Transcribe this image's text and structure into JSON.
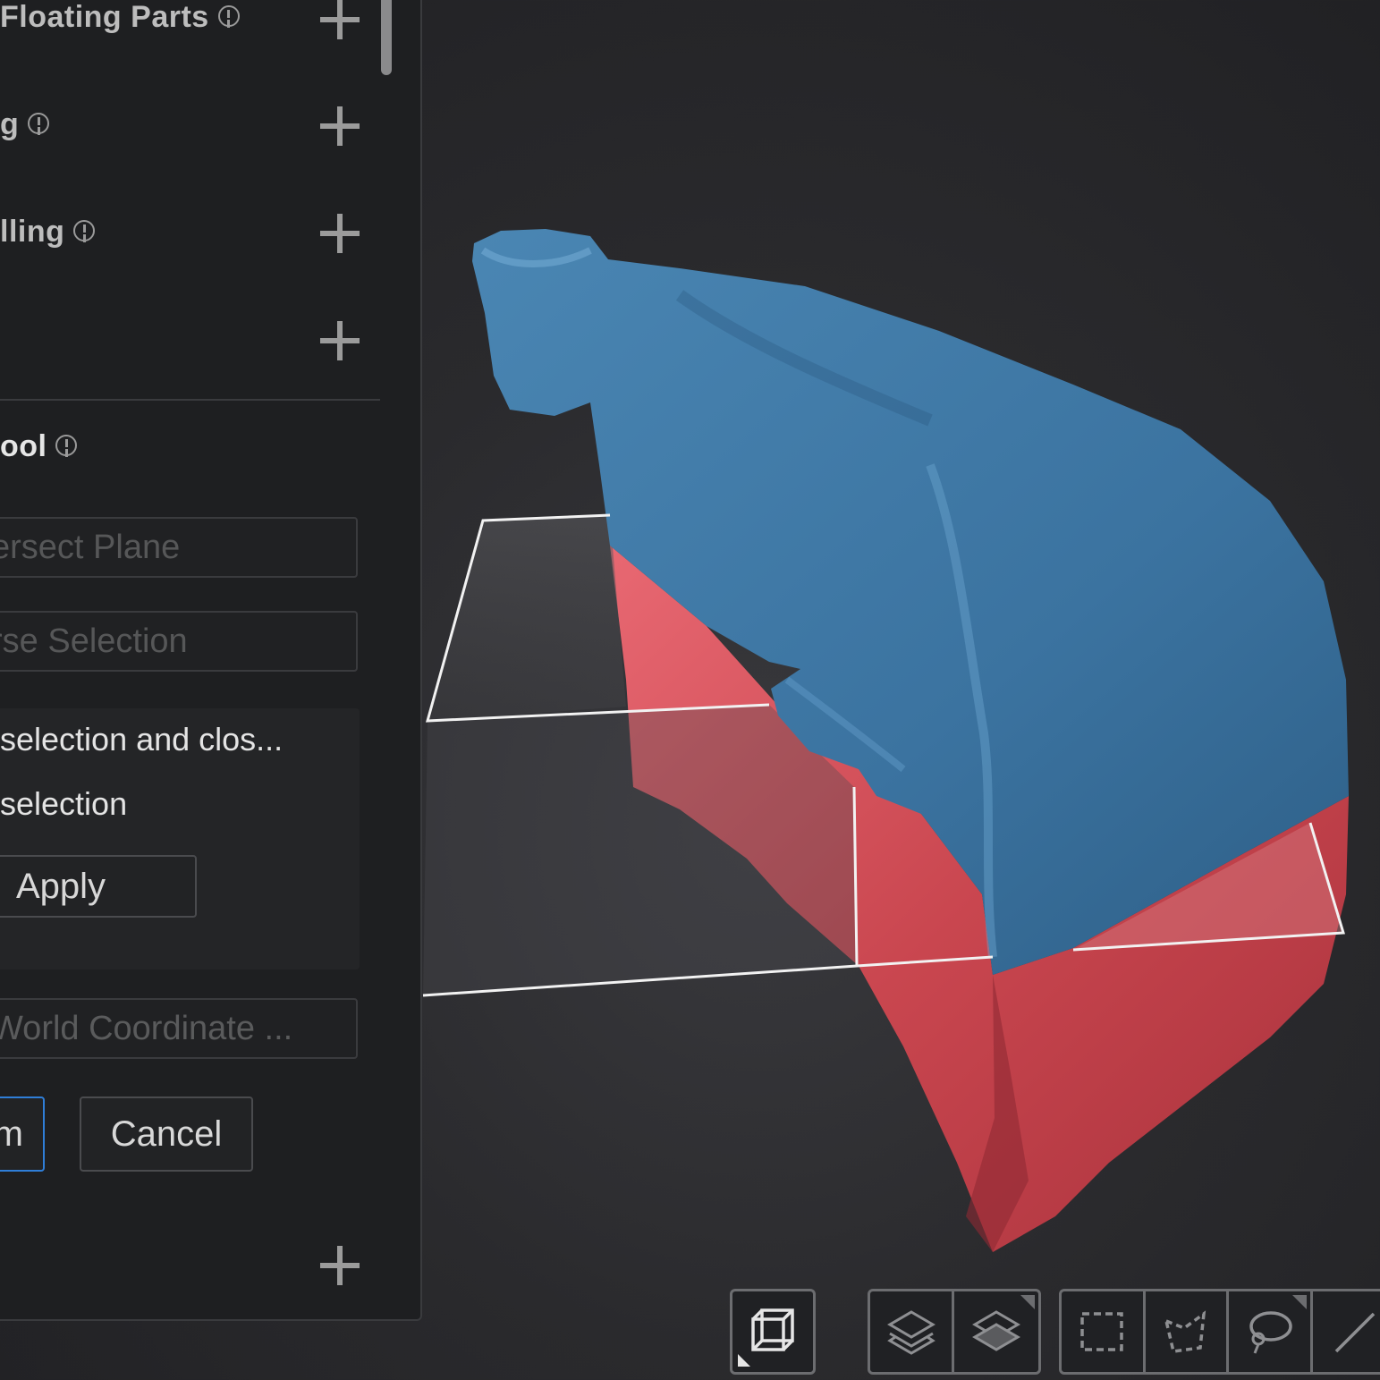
{
  "panel": {
    "rows": [
      {
        "label": "Floating Parts"
      },
      {
        "label": "g"
      },
      {
        "label": "lling"
      },
      {
        "label": ""
      }
    ],
    "tool_section": {
      "title": "ool"
    },
    "fields": {
      "intersect_plane": "ersect Plane",
      "inverse_selection": "rse Selection",
      "world_coordinate": "World Coordinate ..."
    },
    "options": {
      "option1": "selection and clos...",
      "option2": "selection",
      "apply_label": "Apply"
    },
    "buttons": {
      "confirm_label": "m",
      "cancel_label": "Cancel"
    }
  },
  "toolbar": {
    "view_icon": "wireframe-cube-icon",
    "layer_icons": [
      "layers-icon",
      "layers-filled-icon"
    ],
    "selection_icons": [
      "rectangle-select-icon",
      "polygon-select-icon",
      "lasso-select-icon",
      "line-select-icon"
    ]
  },
  "colors": {
    "mesh_selected": "#3e79a5",
    "mesh_unselected": "#c74550",
    "confirm_border": "#2f7ed8",
    "background": "#2a2a2d"
  }
}
